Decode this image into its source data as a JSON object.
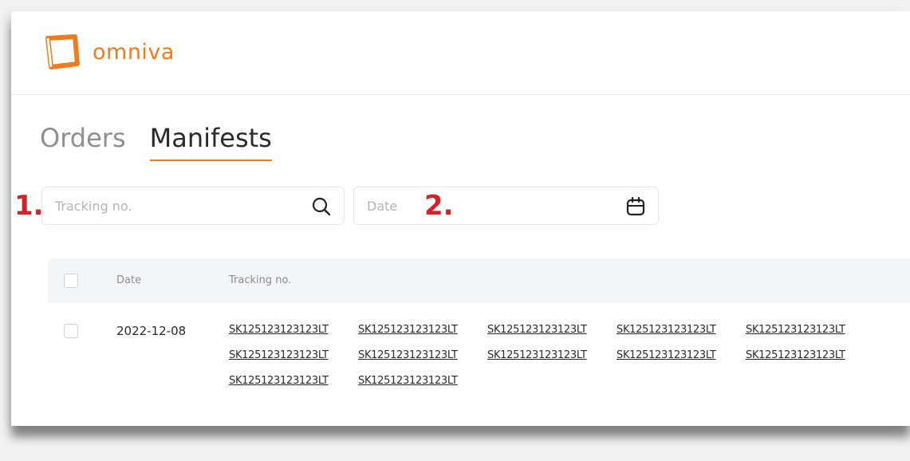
{
  "brand": {
    "name": "omniva",
    "color": "#f07a1e",
    "logo_icon": "omniva-logo-icon"
  },
  "tabs": [
    {
      "label": "Orders",
      "active": false
    },
    {
      "label": "Manifests",
      "active": true
    }
  ],
  "search": {
    "placeholder": "Tracking no.",
    "value": "",
    "icon": "search-icon"
  },
  "date_filter": {
    "placeholder": "Date",
    "value": "",
    "icon": "calendar-icon"
  },
  "annotations": {
    "first": "1.",
    "second": "2.",
    "color": "#d1232a"
  },
  "table": {
    "columns": [
      "",
      "Date",
      "Tracking no."
    ],
    "rows": [
      {
        "checked": false,
        "date": "2022-12-08",
        "tracking": [
          "SK125123123123LT",
          "SK125123123123LT",
          "SK125123123123LT",
          "SK125123123123LT",
          "SK125123123123LT",
          "SK125123123123LT",
          "SK125123123123LT",
          "SK125123123123LT",
          "SK125123123123LT",
          "SK125123123123LT",
          "SK125123123123LT",
          "SK125123123123LT"
        ]
      }
    ]
  }
}
